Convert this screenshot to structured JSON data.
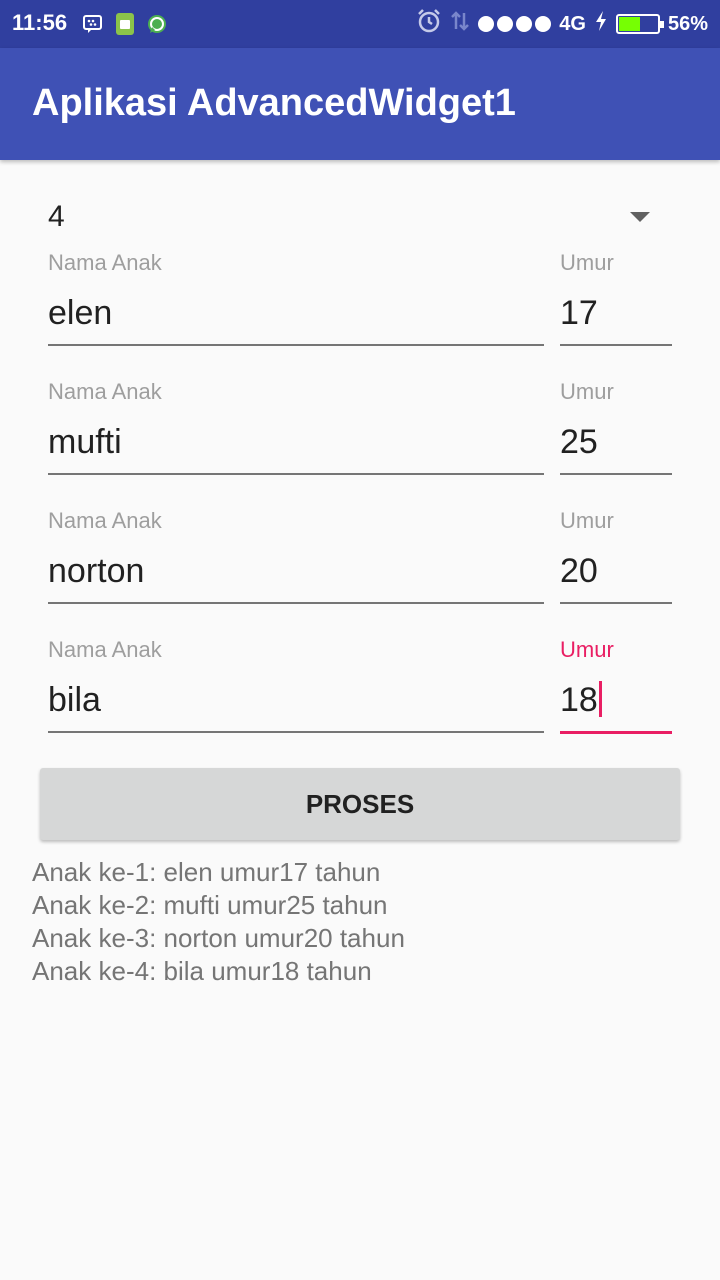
{
  "status_bar": {
    "time": "11:56",
    "network": "4G",
    "battery_percent": "56%",
    "battery_level": 0.56,
    "icons": [
      "bbm-icon",
      "sim-icon",
      "whatsapp-icon",
      "alarm-icon",
      "data-arrows-icon",
      "signal-dots-icon",
      "charging-icon",
      "battery-icon"
    ]
  },
  "app_bar": {
    "title": "Aplikasi AdvancedWidget1"
  },
  "spinner": {
    "selected": "4"
  },
  "rows": [
    {
      "name_label": "Nama Anak",
      "name_value": "elen",
      "age_label": "Umur",
      "age_value": "17"
    },
    {
      "name_label": "Nama Anak",
      "name_value": "mufti",
      "age_label": "Umur",
      "age_value": "25"
    },
    {
      "name_label": "Nama Anak",
      "name_value": "norton",
      "age_label": "Umur",
      "age_value": "20"
    },
    {
      "name_label": "Nama Anak",
      "name_value": "bila",
      "age_label": "Umur",
      "age_value": "18"
    }
  ],
  "button": {
    "label": "PROSES"
  },
  "output": [
    "Anak ke-1: elen umur17 tahun",
    "Anak ke-2: mufti umur25 tahun",
    "Anak ke-3: norton umur20 tahun",
    "Anak ke-4: bila umur18 tahun"
  ],
  "colors": {
    "primary": "#3f51b5",
    "primary_dark": "#303f9f",
    "accent": "#e91e63"
  }
}
